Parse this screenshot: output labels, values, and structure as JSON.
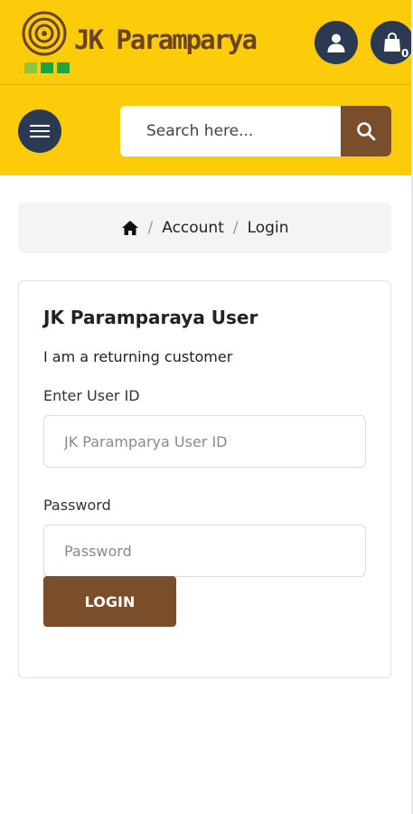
{
  "header": {
    "brand": "JK Paramparya",
    "logo_squares": [
      "#8cc63f",
      "#1fa33a",
      "#1fa33a"
    ],
    "brand_color": "#6a4322",
    "background": "#fccc0a",
    "user_icon": "user-icon",
    "cart_icon": "shopping-bag-icon",
    "cart_count": "0",
    "menu_icon": "hamburger-icon"
  },
  "search": {
    "placeholder": "Search here...",
    "button_icon": "search-icon"
  },
  "breadcrumb": {
    "home_icon": "home-icon",
    "items": [
      "Account",
      "Login"
    ],
    "separator": "/"
  },
  "login": {
    "title": "JK Paramparaya User",
    "subtitle": "I am a returning customer",
    "userid_label": "Enter User ID",
    "userid_placeholder": "JK Paramparya User ID",
    "password_label": "Password",
    "password_placeholder": "Password",
    "button_label": "LOGIN",
    "button_color": "#7a4e2a"
  }
}
